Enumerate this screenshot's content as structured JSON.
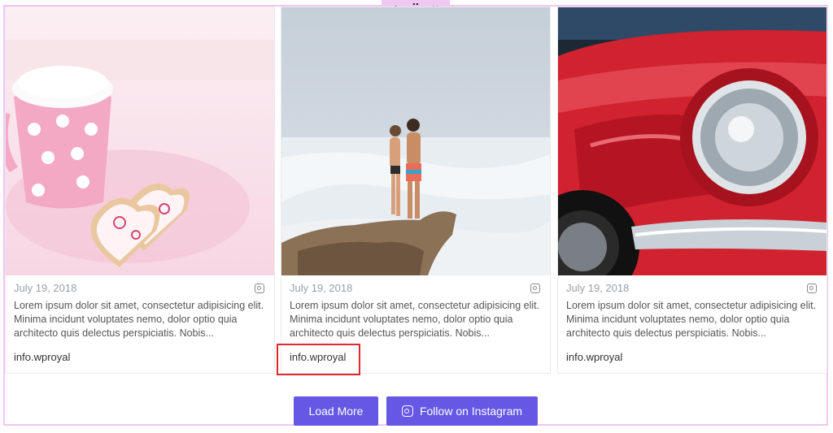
{
  "toolbar": {
    "add": "+",
    "handle": "⠿",
    "close": "×"
  },
  "posts": [
    {
      "date": "July 19, 2018",
      "text": "Lorem ipsum dolor sit amet, consectetur adipisicing elit. Minima incidunt voluptates nemo, dolor optio quia architecto quis delectus perspiciatis. Nobis...",
      "author": "info.wproyal",
      "image": "cup-with-heart-cookies"
    },
    {
      "date": "July 19, 2018",
      "text": "Lorem ipsum dolor sit amet, consectetur adipisicing elit. Minima incidunt voluptates nemo, dolor optio quia architecto quis delectus perspiciatis. Nobis...",
      "author": "info.wproyal",
      "image": "couple-on-rock-by-sea"
    },
    {
      "date": "July 19, 2018",
      "text": "Lorem ipsum dolor sit amet, consectetur adipisicing elit. Minima incidunt voluptates nemo, dolor optio quia architecto quis delectus perspiciatis. Nobis...",
      "author": "info.wproyal",
      "image": "red-car-headlight"
    }
  ],
  "buttons": {
    "load_more": "Load More",
    "follow": "Follow on Instagram"
  },
  "colors": {
    "accent": "#6657e4",
    "frame": "#f0c6f3",
    "highlight": "#e0282e"
  }
}
